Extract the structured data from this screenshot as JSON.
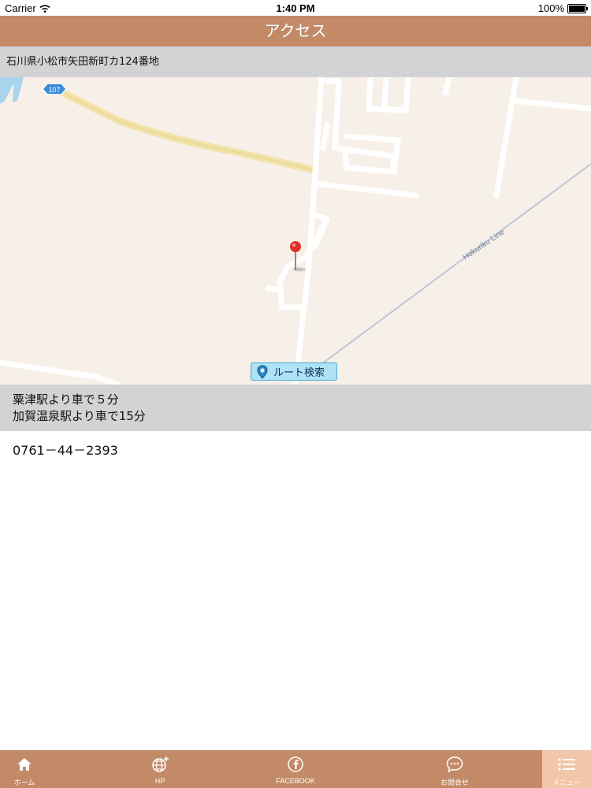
{
  "status_bar": {
    "carrier": "Carrier",
    "time": "1:40 PM",
    "battery": "100%"
  },
  "nav": {
    "title": "アクセス"
  },
  "address": "石川県小松市矢田新町カ124番地",
  "map": {
    "road_number": "107",
    "railway_label": "Hokuriku Line",
    "route_button": "ルート検索"
  },
  "directions": {
    "line1": "粟津駅より車で５分",
    "line2": "加賀温泉駅より車で15分"
  },
  "phone": "0761－44－2393",
  "tabs": [
    {
      "label": "ホーム",
      "icon": "home-icon"
    },
    {
      "label": "HP",
      "icon": "globe-icon"
    },
    {
      "label": "FACEBOOK",
      "icon": "facebook-icon"
    },
    {
      "label": "お問合せ",
      "icon": "chat-bubble-icon"
    },
    {
      "label": "メニュー",
      "icon": "menu-list-icon"
    }
  ],
  "colors": {
    "brand": "#c28a67",
    "active_tab": "#f2c6a9",
    "gray_band": "#d3d3d6",
    "map_bg": "#f7f0e8"
  }
}
